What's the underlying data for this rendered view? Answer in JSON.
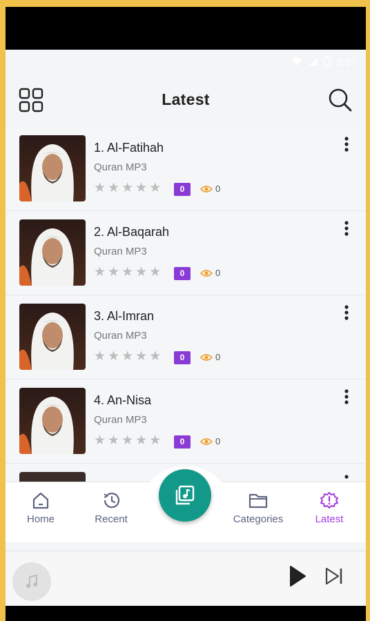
{
  "status": {
    "time": "3:37"
  },
  "header": {
    "title": "Latest"
  },
  "items": [
    {
      "name": "1. Al-Fatihah",
      "category": "Quran MP3",
      "rating_count": "0",
      "views": "0",
      "rating": 0
    },
    {
      "name": "2. Al-Baqarah",
      "category": "Quran MP3",
      "rating_count": "0",
      "views": "0",
      "rating": 0
    },
    {
      "name": "3. Al-Imran",
      "category": "Quran MP3",
      "rating_count": "0",
      "views": "0",
      "rating": 0
    },
    {
      "name": "4. An-Nisa",
      "category": "Quran MP3",
      "rating_count": "0",
      "views": "0",
      "rating": 0
    }
  ],
  "nav": {
    "home": "Home",
    "recent": "Recent",
    "categories": "Categories",
    "latest": "Latest",
    "active": "latest"
  },
  "colors": {
    "accent_purple": "#a33be0",
    "badge_purple": "#8a3bd6",
    "fab_teal": "#13998a",
    "view_orange": "#f0a030"
  }
}
